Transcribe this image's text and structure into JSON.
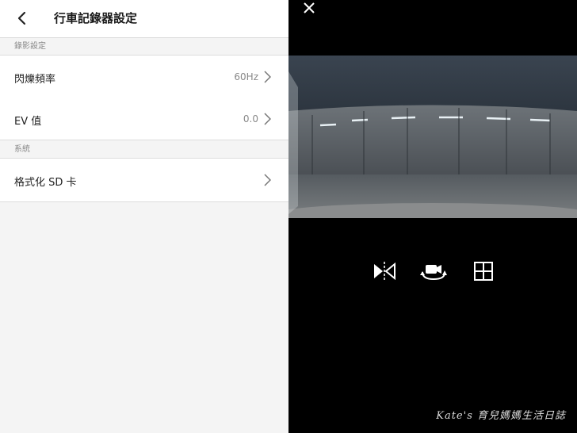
{
  "header": {
    "title": "行車記錄器設定"
  },
  "sections": [
    {
      "label": "錄影設定"
    },
    {
      "label": "系統"
    }
  ],
  "rows": [
    {
      "label": "閃爍頻率",
      "value": "60Hz"
    },
    {
      "label": "EV 值",
      "value": "0.0"
    },
    {
      "label": "格式化 SD 卡",
      "value": ""
    }
  ],
  "preview": {
    "controls": [
      "mirror-icon",
      "switch-camera-icon",
      "grid-icon"
    ]
  },
  "watermark": "Kate's 育兒媽媽生活日誌"
}
